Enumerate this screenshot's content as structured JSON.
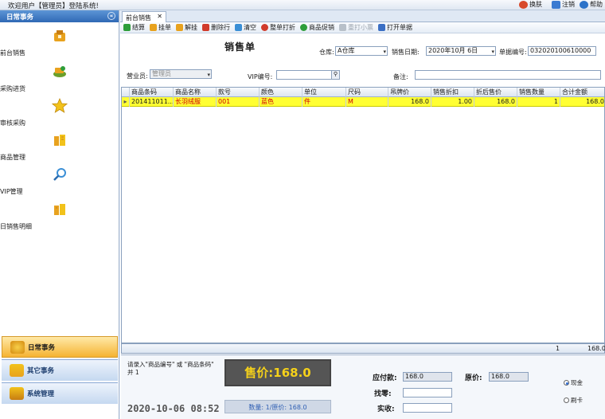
{
  "topbar": {
    "welcome": "欢迎用户【管理员】登陆系统!",
    "skin_label": "换肤",
    "logout_label": "注销",
    "help_label": "帮助"
  },
  "sidebar": {
    "header": "日常事务",
    "items": [
      {
        "label": "前台销售",
        "icon": "shop-icon"
      },
      {
        "label": "采购进货",
        "icon": "purchase-icon"
      },
      {
        "label": "审核采购",
        "icon": "star-icon"
      },
      {
        "label": "商品管理",
        "icon": "goods-icon"
      },
      {
        "label": "VIP管理",
        "icon": "search-icon"
      },
      {
        "label": "日销售明细",
        "icon": "report-icon"
      }
    ],
    "groups": [
      {
        "label": "日常事务",
        "active": true
      },
      {
        "label": "其它事务",
        "active": false
      },
      {
        "label": "系统管理",
        "active": false
      }
    ]
  },
  "tab": {
    "label": "前台销售"
  },
  "toolbar": [
    {
      "label": "结算",
      "color": "#2e9e3a",
      "disabled": false
    },
    {
      "label": "挂单",
      "color": "#e8a21e",
      "disabled": false
    },
    {
      "label": "解挂",
      "color": "#e8a21e",
      "disabled": false
    },
    {
      "label": "删除行",
      "color": "#d13b2b",
      "disabled": false
    },
    {
      "label": "清空",
      "color": "#3b8fd6",
      "disabled": false
    },
    {
      "label": "整单打折",
      "color": "#d13b2b",
      "disabled": false
    },
    {
      "label": "商品促销",
      "color": "#2e9e3a",
      "disabled": false
    },
    {
      "label": "重打小票",
      "color": "#9aa3ad",
      "disabled": true
    },
    {
      "label": "打开单据",
      "color": "#3b6fc4",
      "disabled": false
    }
  ],
  "form": {
    "title": "销售单",
    "warehouse_label": "仓库:",
    "warehouse_value": "A仓库",
    "date_label": "销售日期:",
    "date_value": "2020年10月 6日",
    "doc_no_label": "单据编号:",
    "doc_no_value": "032020100610000",
    "clerk_label": "营业员:",
    "clerk_value": "管理员",
    "vip_label": "VIP编号:",
    "vip_value": "",
    "note_label": "备注:",
    "note_value": ""
  },
  "grid": {
    "columns": [
      "商品条码",
      "商品名称",
      "款号",
      "颜色",
      "单位",
      "尺码",
      "吊牌价",
      "销售折扣",
      "折后售价",
      "销售数量",
      "合计金额"
    ],
    "rows": [
      [
        "201411011...",
        "长羽绒服",
        "001",
        "蓝色",
        "件",
        "M",
        "168.0",
        "1.00",
        "168.0",
        "1",
        "168.0"
      ]
    ],
    "total_qty": "1",
    "total_amount": "168.0"
  },
  "bottom": {
    "hint": "请录入\"商品编号\" 或 \"商品条码\" 并 1",
    "clock": "2020-10-06 08:52",
    "price_text": "售价:168.0",
    "qty_text": "数量: 1/原价: 168.0",
    "due_label": "应付款:",
    "due_value": "168.0",
    "original_label": "原价:",
    "original_value": "168.0",
    "change_label": "找零:",
    "change_value": "",
    "received_label": "实收:",
    "received_value": "",
    "pay_cash": "现金",
    "pay_card": "刷卡"
  }
}
